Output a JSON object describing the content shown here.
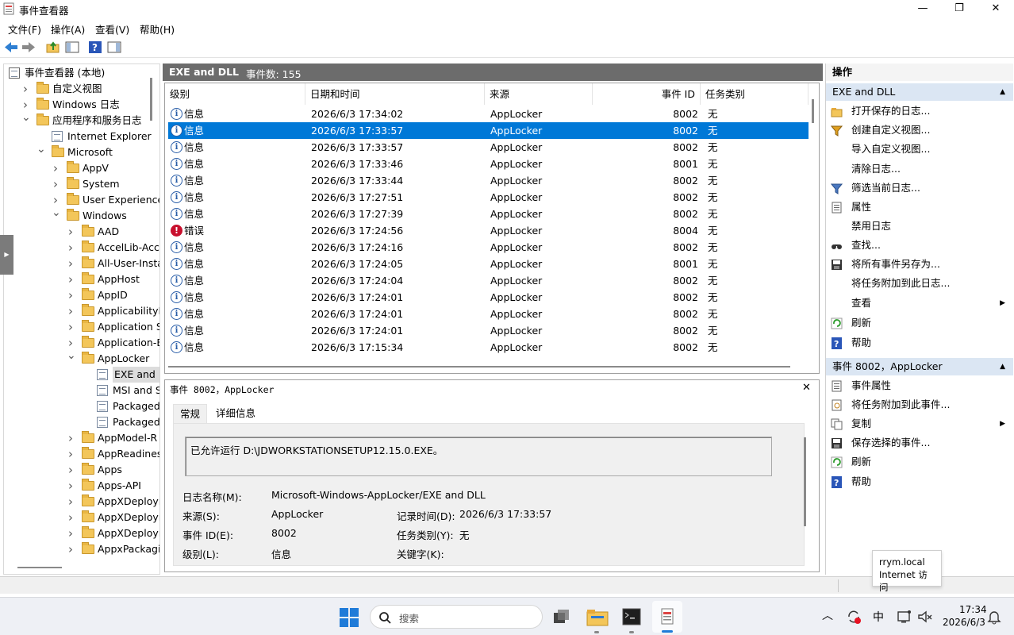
{
  "window": {
    "title": "事件查看器",
    "minimize": "—",
    "restore": "❐",
    "close": "✕"
  },
  "menu": [
    "文件(F)",
    "操作(A)",
    "查看(V)",
    "帮助(H)"
  ],
  "tree": [
    {
      "label": "事件查看器 (本地)",
      "indent": 0,
      "arrow": "",
      "icon": "root"
    },
    {
      "label": "自定义视图",
      "indent": 1,
      "arrow": "›",
      "icon": "folder"
    },
    {
      "label": "Windows 日志",
      "indent": 1,
      "arrow": "›",
      "icon": "folder"
    },
    {
      "label": "应用程序和服务日志",
      "indent": 1,
      "arrow": "⌄",
      "icon": "folder"
    },
    {
      "label": "Internet Explorer",
      "indent": 2,
      "arrow": "",
      "icon": "log"
    },
    {
      "label": "Microsoft",
      "indent": 2,
      "arrow": "⌄",
      "icon": "folder"
    },
    {
      "label": "AppV",
      "indent": 3,
      "arrow": "›",
      "icon": "folder"
    },
    {
      "label": "System",
      "indent": 3,
      "arrow": "›",
      "icon": "folder"
    },
    {
      "label": "User Experience",
      "indent": 3,
      "arrow": "›",
      "icon": "folder"
    },
    {
      "label": "Windows",
      "indent": 3,
      "arrow": "⌄",
      "icon": "folder"
    },
    {
      "label": "AAD",
      "indent": 4,
      "arrow": "›",
      "icon": "folder"
    },
    {
      "label": "AccelLib-Acce",
      "indent": 4,
      "arrow": "›",
      "icon": "folder"
    },
    {
      "label": "All-User-Insta",
      "indent": 4,
      "arrow": "›",
      "icon": "folder"
    },
    {
      "label": "AppHost",
      "indent": 4,
      "arrow": "›",
      "icon": "folder"
    },
    {
      "label": "AppID",
      "indent": 4,
      "arrow": "›",
      "icon": "folder"
    },
    {
      "label": "ApplicabilityE",
      "indent": 4,
      "arrow": "›",
      "icon": "folder"
    },
    {
      "label": "Application S",
      "indent": 4,
      "arrow": "›",
      "icon": "folder"
    },
    {
      "label": "Application-E",
      "indent": 4,
      "arrow": "›",
      "icon": "folder"
    },
    {
      "label": "AppLocker",
      "indent": 4,
      "arrow": "⌄",
      "icon": "folder"
    },
    {
      "label": "EXE and D",
      "indent": 5,
      "arrow": "",
      "icon": "log",
      "selected": true
    },
    {
      "label": "MSI and S",
      "indent": 5,
      "arrow": "",
      "icon": "log"
    },
    {
      "label": "Packaged",
      "indent": 5,
      "arrow": "",
      "icon": "log"
    },
    {
      "label": "Packaged",
      "indent": 5,
      "arrow": "",
      "icon": "log"
    },
    {
      "label": "AppModel-R",
      "indent": 4,
      "arrow": "›",
      "icon": "folder"
    },
    {
      "label": "AppReadines",
      "indent": 4,
      "arrow": "›",
      "icon": "folder"
    },
    {
      "label": "Apps",
      "indent": 4,
      "arrow": "›",
      "icon": "folder"
    },
    {
      "label": "Apps-API",
      "indent": 4,
      "arrow": "›",
      "icon": "folder"
    },
    {
      "label": "AppXDeployı",
      "indent": 4,
      "arrow": "›",
      "icon": "folder"
    },
    {
      "label": "AppXDeployı",
      "indent": 4,
      "arrow": "›",
      "icon": "folder"
    },
    {
      "label": "AppXDeployı",
      "indent": 4,
      "arrow": "›",
      "icon": "folder"
    },
    {
      "label": "AppxPackagi",
      "indent": 4,
      "arrow": "›",
      "icon": "folder"
    }
  ],
  "center": {
    "log_name": "EXE and DLL",
    "event_count": "事件数: 155",
    "columns": [
      "级别",
      "日期和时间",
      "来源",
      "事件 ID",
      "任务类别"
    ],
    "rows": [
      {
        "level": "信息",
        "type": "info",
        "datetime": "2026/6/3 17:34:02",
        "source": "AppLocker",
        "id": "8002",
        "task": "无"
      },
      {
        "level": "信息",
        "type": "info",
        "datetime": "2026/6/3 17:33:57",
        "source": "AppLocker",
        "id": "8002",
        "task": "无",
        "selected": true
      },
      {
        "level": "信息",
        "type": "info",
        "datetime": "2026/6/3 17:33:57",
        "source": "AppLocker",
        "id": "8002",
        "task": "无"
      },
      {
        "level": "信息",
        "type": "info",
        "datetime": "2026/6/3 17:33:46",
        "source": "AppLocker",
        "id": "8001",
        "task": "无"
      },
      {
        "level": "信息",
        "type": "info",
        "datetime": "2026/6/3 17:33:44",
        "source": "AppLocker",
        "id": "8002",
        "task": "无"
      },
      {
        "level": "信息",
        "type": "info",
        "datetime": "2026/6/3 17:27:51",
        "source": "AppLocker",
        "id": "8002",
        "task": "无"
      },
      {
        "level": "信息",
        "type": "info",
        "datetime": "2026/6/3 17:27:39",
        "source": "AppLocker",
        "id": "8002",
        "task": "无"
      },
      {
        "level": "错误",
        "type": "error",
        "datetime": "2026/6/3 17:24:56",
        "source": "AppLocker",
        "id": "8004",
        "task": "无"
      },
      {
        "level": "信息",
        "type": "info",
        "datetime": "2026/6/3 17:24:16",
        "source": "AppLocker",
        "id": "8002",
        "task": "无"
      },
      {
        "level": "信息",
        "type": "info",
        "datetime": "2026/6/3 17:24:05",
        "source": "AppLocker",
        "id": "8001",
        "task": "无"
      },
      {
        "level": "信息",
        "type": "info",
        "datetime": "2026/6/3 17:24:04",
        "source": "AppLocker",
        "id": "8002",
        "task": "无"
      },
      {
        "level": "信息",
        "type": "info",
        "datetime": "2026/6/3 17:24:01",
        "source": "AppLocker",
        "id": "8002",
        "task": "无"
      },
      {
        "level": "信息",
        "type": "info",
        "datetime": "2026/6/3 17:24:01",
        "source": "AppLocker",
        "id": "8002",
        "task": "无"
      },
      {
        "level": "信息",
        "type": "info",
        "datetime": "2026/6/3 17:24:01",
        "source": "AppLocker",
        "id": "8002",
        "task": "无"
      },
      {
        "level": "信息",
        "type": "info",
        "datetime": "2026/6/3 17:15:34",
        "source": "AppLocker",
        "id": "8002",
        "task": "无"
      }
    ]
  },
  "detail": {
    "title": "事件 8002，AppLocker",
    "close": "✕",
    "tabs": [
      "常规",
      "详细信息"
    ],
    "message": "已允许运行 D:\\JDWORKSTATIONSETUP12.15.0.EXE。",
    "fields": {
      "log_name_label": "日志名称(M):",
      "log_name_value": "Microsoft-Windows-AppLocker/EXE and DLL",
      "source_label": "来源(S):",
      "source_value": "AppLocker",
      "logged_label": "记录时间(D):",
      "logged_value": "2026/6/3 17:33:57",
      "event_id_label": "事件 ID(E):",
      "event_id_value": "8002",
      "task_label": "任务类别(Y):",
      "task_value": "无",
      "level_label": "级别(L):",
      "level_value": "信息",
      "keywords_label": "关键字(K):"
    }
  },
  "actions": {
    "header": "操作",
    "group1": "EXE and DLL",
    "items1": [
      {
        "label": "打开保存的日志...",
        "icon": "open-log-icon"
      },
      {
        "label": "创建自定义视图...",
        "icon": "filter-create-icon"
      },
      {
        "label": "导入自定义视图...",
        "icon": ""
      },
      {
        "label": "清除日志...",
        "icon": ""
      },
      {
        "label": "筛选当前日志...",
        "icon": "filter-icon"
      },
      {
        "label": "属性",
        "icon": "properties-icon"
      },
      {
        "label": "禁用日志",
        "icon": ""
      },
      {
        "label": "查找...",
        "icon": "find-icon"
      },
      {
        "label": "将所有事件另存为...",
        "icon": "save-icon"
      },
      {
        "label": "将任务附加到此日志...",
        "icon": ""
      },
      {
        "label": "查看",
        "icon": "",
        "submenu": true
      },
      {
        "label": "刷新",
        "icon": "refresh-icon"
      },
      {
        "label": "帮助",
        "icon": "help-icon"
      }
    ],
    "group2": "事件 8002，AppLocker",
    "items2": [
      {
        "label": "事件属性",
        "icon": "properties-icon"
      },
      {
        "label": "将任务附加到此事件...",
        "icon": "attach-task-icon"
      },
      {
        "label": "复制",
        "icon": "copy-icon",
        "submenu": true
      },
      {
        "label": "保存选择的事件...",
        "icon": "save-icon"
      },
      {
        "label": "刷新",
        "icon": "refresh-icon"
      },
      {
        "label": "帮助",
        "icon": "help-icon"
      }
    ]
  },
  "tooltip": {
    "line1": "rrym.local",
    "line2": "Internet 访问"
  },
  "taskbar": {
    "search_placeholder": "搜索",
    "ime": "中",
    "time": "17:34",
    "date": "2026/6/3"
  },
  "colors": {
    "selection": "#0078d7",
    "panel_header": "#6c6c6c",
    "group_header": "#dbe6f3"
  }
}
